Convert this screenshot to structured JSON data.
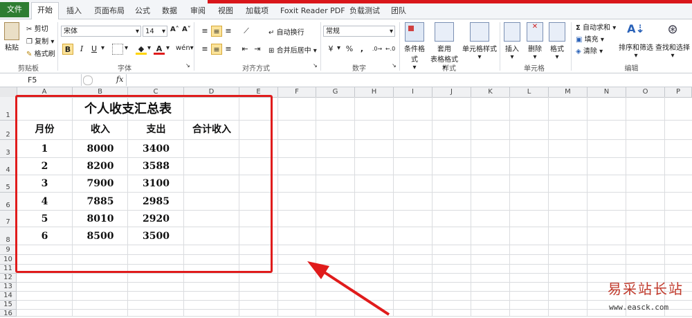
{
  "tabs": {
    "file": "文件",
    "items": [
      "开始",
      "插入",
      "页面布局",
      "公式",
      "数据",
      "审阅",
      "视图",
      "加载项",
      "Foxit Reader PDF",
      "负载测试",
      "团队"
    ]
  },
  "clipboard": {
    "paste": "粘贴",
    "cut": "剪切",
    "copy": "复制",
    "format_painter": "格式刷",
    "label": "剪贴板"
  },
  "font": {
    "name": "宋体",
    "size": "14",
    "label": "字体",
    "bold": "B",
    "italic": "I",
    "underline": "U",
    "phonetic": "wén"
  },
  "alignment": {
    "wrap": "自动换行",
    "merge": "合并后居中",
    "label": "对齐方式"
  },
  "number": {
    "format": "常规",
    "percent": "%",
    "comma": ",",
    "label": "数字"
  },
  "styles": {
    "conditional": "条件格式",
    "table1": "套用",
    "table2": "表格格式",
    "cell_styles": "单元格样式",
    "label": "样式"
  },
  "cells": {
    "insert": "插入",
    "delete": "删除",
    "format": "格式",
    "label": "单元格"
  },
  "editing": {
    "autosum": "自动求和",
    "fill": "填充",
    "clear": "清除",
    "sort": "排序和筛选",
    "find": "查找和选择",
    "label": "编辑"
  },
  "formula_bar": {
    "name_box": "F5",
    "fx": "fx",
    "value": ""
  },
  "columns": [
    "A",
    "B",
    "C",
    "D",
    "E",
    "F",
    "G",
    "H",
    "I",
    "J",
    "K",
    "L",
    "M",
    "N",
    "O",
    "P"
  ],
  "rows": [
    "1",
    "2",
    "3",
    "4",
    "5",
    "6",
    "7",
    "8",
    "9",
    "10",
    "11",
    "12",
    "13",
    "14",
    "15",
    "16"
  ],
  "sheet": {
    "title": "个人收支汇总表",
    "headers": [
      "月份",
      "收入",
      "支出",
      "合计收入"
    ],
    "data": [
      [
        "1",
        "8000",
        "3400",
        ""
      ],
      [
        "2",
        "8200",
        "3588",
        ""
      ],
      [
        "3",
        "7900",
        "3100",
        ""
      ],
      [
        "4",
        "7885",
        "2985",
        ""
      ],
      [
        "5",
        "8010",
        "2920",
        ""
      ],
      [
        "6",
        "8500",
        "3500",
        ""
      ]
    ]
  },
  "watermark": {
    "name": "易采站长站",
    "url": "www.easck.com"
  },
  "colors": {
    "highlight_box": "#e01b1b",
    "arrow": "#e01b1b",
    "file_tab": "#2e7d32"
  }
}
